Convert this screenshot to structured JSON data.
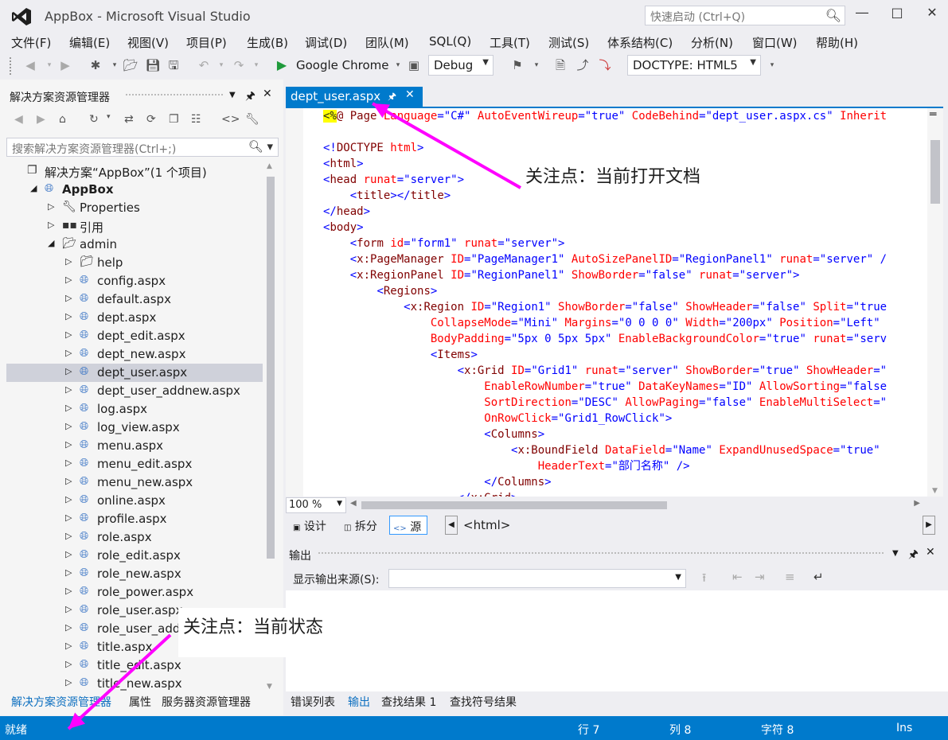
{
  "window": {
    "title": "AppBox - Microsoft Visual Studio",
    "quick_launch_placeholder": "快速启动 (Ctrl+Q)"
  },
  "menu": [
    "文件(F)",
    "编辑(E)",
    "视图(V)",
    "项目(P)",
    "生成(B)",
    "调试(D)",
    "团队(M)",
    "SQL(Q)",
    "工具(T)",
    "测试(S)",
    "体系结构(C)",
    "分析(N)",
    "窗口(W)",
    "帮助(H)"
  ],
  "toolbar": {
    "run_target": "Google Chrome",
    "config": "Debug",
    "doctype": "DOCTYPE: HTML5"
  },
  "solution_explorer": {
    "title": "解决方案资源管理器",
    "search_placeholder": "搜索解决方案资源管理器(Ctrl+;)",
    "items": [
      {
        "label": "解决方案“AppBox”(1 个项目)",
        "kind": "solution"
      },
      {
        "label": "AppBox",
        "kind": "project"
      },
      {
        "label": "Properties",
        "kind": "properties"
      },
      {
        "label": "引用",
        "kind": "references"
      },
      {
        "label": "admin",
        "kind": "folder-open"
      },
      {
        "label": "help",
        "kind": "folder"
      },
      {
        "label": "config.aspx",
        "kind": "aspx"
      },
      {
        "label": "default.aspx",
        "kind": "aspx"
      },
      {
        "label": "dept.aspx",
        "kind": "aspx"
      },
      {
        "label": "dept_edit.aspx",
        "kind": "aspx"
      },
      {
        "label": "dept_new.aspx",
        "kind": "aspx"
      },
      {
        "label": "dept_user.aspx",
        "kind": "aspx",
        "selected": true
      },
      {
        "label": "dept_user_addnew.aspx",
        "kind": "aspx"
      },
      {
        "label": "log.aspx",
        "kind": "aspx"
      },
      {
        "label": "log_view.aspx",
        "kind": "aspx"
      },
      {
        "label": "menu.aspx",
        "kind": "aspx"
      },
      {
        "label": "menu_edit.aspx",
        "kind": "aspx"
      },
      {
        "label": "menu_new.aspx",
        "kind": "aspx"
      },
      {
        "label": "online.aspx",
        "kind": "aspx"
      },
      {
        "label": "profile.aspx",
        "kind": "aspx"
      },
      {
        "label": "role.aspx",
        "kind": "aspx"
      },
      {
        "label": "role_edit.aspx",
        "kind": "aspx"
      },
      {
        "label": "role_new.aspx",
        "kind": "aspx"
      },
      {
        "label": "role_power.aspx",
        "kind": "aspx"
      },
      {
        "label": "role_user.aspx",
        "kind": "aspx"
      },
      {
        "label": "role_user_addnew.aspx",
        "kind": "aspx"
      },
      {
        "label": "title.aspx",
        "kind": "aspx"
      },
      {
        "label": "title_edit.aspx",
        "kind": "aspx"
      },
      {
        "label": "title_new.aspx",
        "kind": "aspx"
      }
    ],
    "bottom_tabs": [
      "解决方案资源管理器",
      "属性",
      "服务器资源管理器"
    ]
  },
  "editor": {
    "tab_label": "dept_user.aspx",
    "zoom": "100 %",
    "view_tabs": [
      "设计",
      "拆分",
      "源"
    ],
    "active_view": "源",
    "path": "<html>",
    "lines": [
      [
        [
          "dir",
          "<%"
        ],
        [
          "asp",
          "@ Page "
        ],
        [
          "attr",
          "Language"
        ],
        [
          "tag",
          "=\"C#\" "
        ],
        [
          "attr",
          "AutoEventWireup"
        ],
        [
          "tag",
          "=\"true\" "
        ],
        [
          "attr",
          "CodeBehind"
        ],
        [
          "tag",
          "=\"dept_user.aspx.cs\" "
        ],
        [
          "attr",
          "Inherit"
        ]
      ],
      [],
      [
        [
          "tag",
          "<!"
        ],
        [
          "asp",
          "DOCTYPE "
        ],
        [
          "attr",
          "html"
        ],
        [
          "tag",
          ">"
        ]
      ],
      [
        [
          "tag",
          "<"
        ],
        [
          "asp",
          "html"
        ],
        [
          "tag",
          ">"
        ]
      ],
      [
        [
          "tag",
          "<"
        ],
        [
          "asp",
          "head "
        ],
        [
          "attr",
          "runat"
        ],
        [
          "tag",
          "=\"server\">"
        ]
      ],
      [
        [
          "pl",
          "    "
        ],
        [
          "tag",
          "<"
        ],
        [
          "asp",
          "title"
        ],
        [
          "tag",
          "></"
        ],
        [
          "asp",
          "title"
        ],
        [
          "tag",
          ">"
        ]
      ],
      [
        [
          "tag",
          "</"
        ],
        [
          "asp",
          "head"
        ],
        [
          "tag",
          ">"
        ]
      ],
      [
        [
          "tag",
          "<"
        ],
        [
          "asp",
          "body"
        ],
        [
          "tag",
          ">"
        ]
      ],
      [
        [
          "pl",
          "    "
        ],
        [
          "tag",
          "<"
        ],
        [
          "asp",
          "form "
        ],
        [
          "attr",
          "id"
        ],
        [
          "tag",
          "=\"form1\" "
        ],
        [
          "attr",
          "runat"
        ],
        [
          "tag",
          "=\"server\">"
        ]
      ],
      [
        [
          "pl",
          "    "
        ],
        [
          "tag",
          "<"
        ],
        [
          "asp",
          "x:PageManager "
        ],
        [
          "attr",
          "ID"
        ],
        [
          "tag",
          "=\"PageManager1\" "
        ],
        [
          "attr",
          "AutoSizePanelID"
        ],
        [
          "tag",
          "=\"RegionPanel1\" "
        ],
        [
          "attr",
          "runat"
        ],
        [
          "tag",
          "=\"server\" /"
        ]
      ],
      [
        [
          "pl",
          "    "
        ],
        [
          "tag",
          "<"
        ],
        [
          "asp",
          "x:RegionPanel "
        ],
        [
          "attr",
          "ID"
        ],
        [
          "tag",
          "=\"RegionPanel1\" "
        ],
        [
          "attr",
          "ShowBorder"
        ],
        [
          "tag",
          "=\"false\" "
        ],
        [
          "attr",
          "runat"
        ],
        [
          "tag",
          "=\"server\">"
        ]
      ],
      [
        [
          "pl",
          "        "
        ],
        [
          "tag",
          "<"
        ],
        [
          "asp",
          "Regions"
        ],
        [
          "tag",
          ">"
        ]
      ],
      [
        [
          "pl",
          "            "
        ],
        [
          "tag",
          "<"
        ],
        [
          "asp",
          "x:Region "
        ],
        [
          "attr",
          "ID"
        ],
        [
          "tag",
          "=\"Region1\" "
        ],
        [
          "attr",
          "ShowBorder"
        ],
        [
          "tag",
          "=\"false\" "
        ],
        [
          "attr",
          "ShowHeader"
        ],
        [
          "tag",
          "=\"false\" "
        ],
        [
          "attr",
          "Split"
        ],
        [
          "tag",
          "=\"true"
        ]
      ],
      [
        [
          "pl",
          "                "
        ],
        [
          "attr",
          "CollapseMode"
        ],
        [
          "tag",
          "=\"Mini\" "
        ],
        [
          "attr",
          "Margins"
        ],
        [
          "tag",
          "=\"0 0 0 0\" "
        ],
        [
          "attr",
          "Width"
        ],
        [
          "tag",
          "=\"200px\" "
        ],
        [
          "attr",
          "Position"
        ],
        [
          "tag",
          "=\"Left\" "
        ]
      ],
      [
        [
          "pl",
          "                "
        ],
        [
          "attr",
          "BodyPadding"
        ],
        [
          "tag",
          "=\"5px 0 5px 5px\" "
        ],
        [
          "attr",
          "EnableBackgroundColor"
        ],
        [
          "tag",
          "=\"true\" "
        ],
        [
          "attr",
          "runat"
        ],
        [
          "tag",
          "=\"serv"
        ]
      ],
      [
        [
          "pl",
          "                "
        ],
        [
          "tag",
          "<"
        ],
        [
          "asp",
          "Items"
        ],
        [
          "tag",
          ">"
        ]
      ],
      [
        [
          "pl",
          "                    "
        ],
        [
          "tag",
          "<"
        ],
        [
          "asp",
          "x:Grid "
        ],
        [
          "attr",
          "ID"
        ],
        [
          "tag",
          "=\"Grid1\" "
        ],
        [
          "attr",
          "runat"
        ],
        [
          "tag",
          "=\"server\" "
        ],
        [
          "attr",
          "ShowBorder"
        ],
        [
          "tag",
          "=\"true\" "
        ],
        [
          "attr",
          "ShowHeader"
        ],
        [
          "tag",
          "=\""
        ]
      ],
      [
        [
          "pl",
          "                        "
        ],
        [
          "attr",
          "EnableRowNumber"
        ],
        [
          "tag",
          "=\"true\" "
        ],
        [
          "attr",
          "DataKeyNames"
        ],
        [
          "tag",
          "=\"ID\" "
        ],
        [
          "attr",
          "AllowSorting"
        ],
        [
          "tag",
          "=\"false"
        ]
      ],
      [
        [
          "pl",
          "                        "
        ],
        [
          "attr",
          "SortDirection"
        ],
        [
          "tag",
          "=\"DESC\" "
        ],
        [
          "attr",
          "AllowPaging"
        ],
        [
          "tag",
          "=\"false\" "
        ],
        [
          "attr",
          "EnableMultiSelect"
        ],
        [
          "tag",
          "=\""
        ]
      ],
      [
        [
          "pl",
          "                        "
        ],
        [
          "attr",
          "OnRowClick"
        ],
        [
          "tag",
          "=\"Grid1_RowClick\">"
        ]
      ],
      [
        [
          "pl",
          "                        "
        ],
        [
          "tag",
          "<"
        ],
        [
          "asp",
          "Columns"
        ],
        [
          "tag",
          ">"
        ]
      ],
      [
        [
          "pl",
          "                            "
        ],
        [
          "tag",
          "<"
        ],
        [
          "asp",
          "x:BoundField "
        ],
        [
          "attr",
          "DataField"
        ],
        [
          "tag",
          "=\"Name\" "
        ],
        [
          "attr",
          "ExpandUnusedSpace"
        ],
        [
          "tag",
          "=\"true\" "
        ]
      ],
      [
        [
          "pl",
          "                                "
        ],
        [
          "attr",
          "HeaderText"
        ],
        [
          "tag",
          "=\"部门名称\" />"
        ]
      ],
      [
        [
          "pl",
          "                        "
        ],
        [
          "tag",
          "</"
        ],
        [
          "asp",
          "Columns"
        ],
        [
          "tag",
          ">"
        ]
      ],
      [
        [
          "pl",
          "                    "
        ],
        [
          "tag",
          "</"
        ],
        [
          "asp",
          "x:Grid"
        ],
        [
          "tag",
          ">"
        ]
      ]
    ]
  },
  "output": {
    "title": "输出",
    "source_label": "显示输出来源(S):",
    "source_value": "",
    "tabs": [
      "错误列表",
      "输出",
      "查找结果 1",
      "查找符号结果"
    ],
    "active_tab": "输出"
  },
  "statusbar": {
    "state": "就绪",
    "line": "行 7",
    "col": "列 8",
    "char": "字符 8",
    "mode": "Ins"
  },
  "annotations": {
    "doc_note": "关注点：当前打开文档",
    "status_note": "关注点：当前状态",
    "arrow_color": "#ff00ff"
  }
}
